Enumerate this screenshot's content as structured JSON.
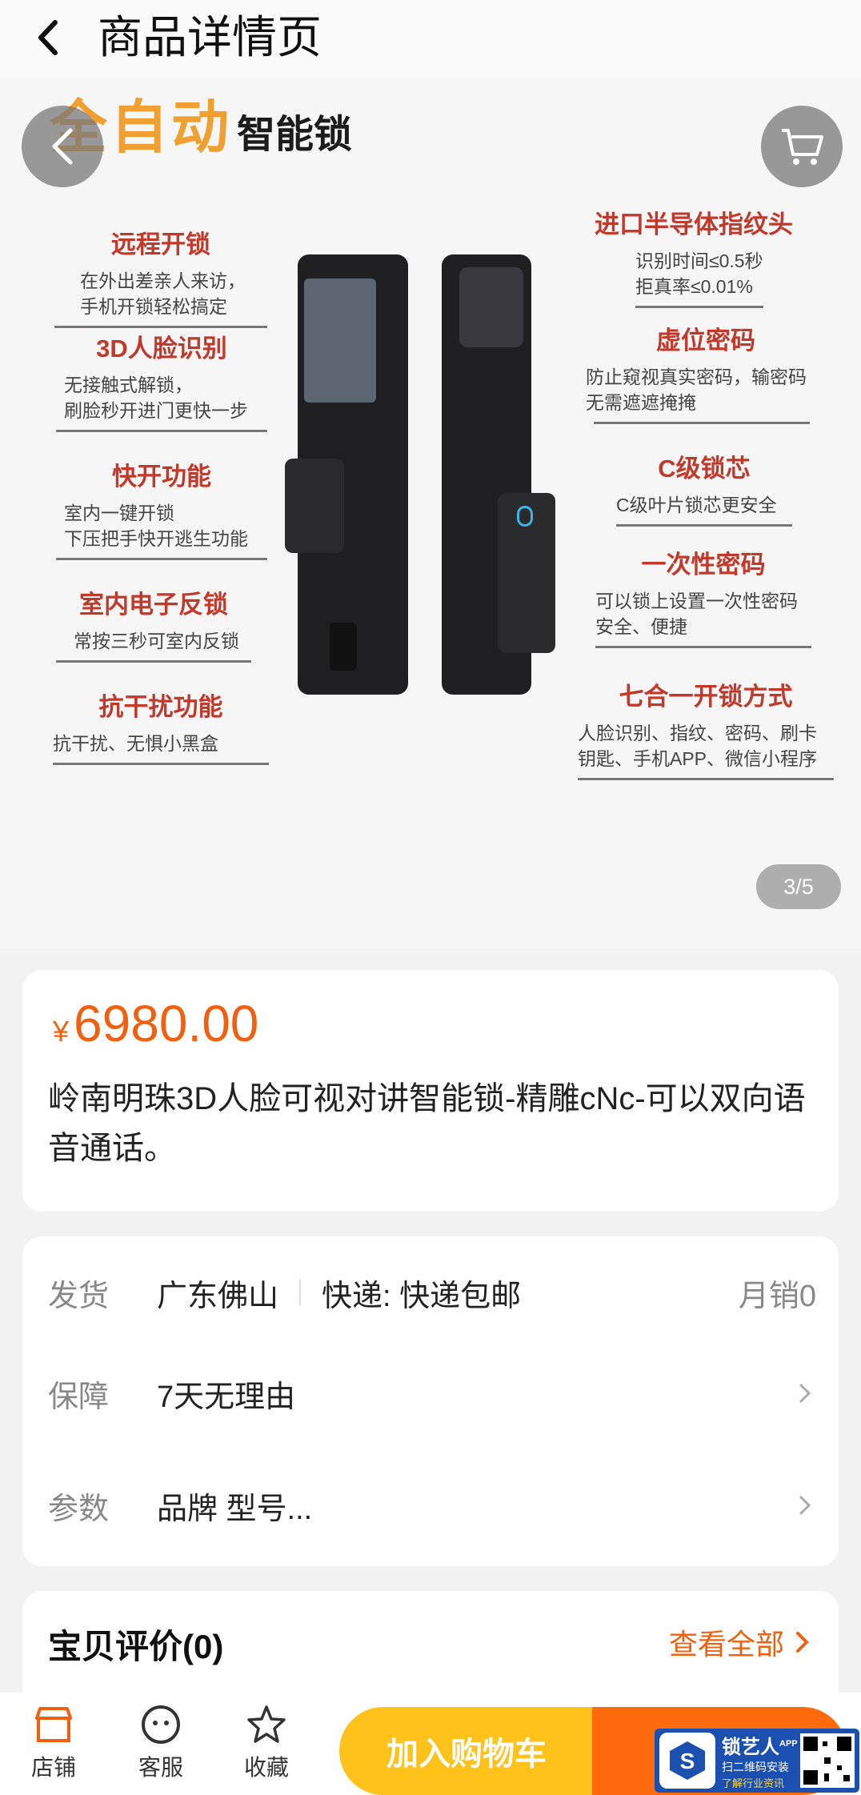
{
  "header": {
    "title": "商品详情页"
  },
  "gallery": {
    "headline_big": "全自动",
    "headline_small": "智能锁",
    "counter": "3/5",
    "features_left": [
      {
        "title": "远程开锁",
        "desc": "在外出差亲人来访，\n手机开锁轻松搞定"
      },
      {
        "title": "3D人脸识别",
        "desc": "无接触式解锁，\n刷脸秒开进门更快一步"
      },
      {
        "title": "快开功能",
        "desc": "室内一键开锁\n下压把手快开逃生功能"
      },
      {
        "title": "室内电子反锁",
        "desc": "常按三秒可室内反锁"
      },
      {
        "title": "抗干扰功能",
        "desc": "抗干扰、无惧小黑盒"
      }
    ],
    "features_right": [
      {
        "title": "进口半导体指纹头",
        "desc": "识别时间≤0.5秒\n拒真率≤0.01%"
      },
      {
        "title": "虚位密码",
        "desc": "防止窥视真实密码，输密码\n无需遮遮掩掩"
      },
      {
        "title": "C级锁芯",
        "desc": "C级叶片锁芯更安全"
      },
      {
        "title": "一次性密码",
        "desc": "可以锁上设置一次性密码\n安全、便捷"
      },
      {
        "title": "七合一开锁方式",
        "desc": "人脸识别、指纹、密码、刷卡\n钥匙、手机APP、微信小程序"
      }
    ]
  },
  "product": {
    "currency": "¥",
    "price": "6980.00",
    "title": "岭南明珠3D人脸可视对讲智能锁-精雕cNc-可以双向语音通话。"
  },
  "info": {
    "ship_label": "发货",
    "ship_from": "广东佛山",
    "express": "快递: 快递包邮",
    "monthly_sales": "月销0",
    "guarantee_label": "保障",
    "guarantee_value": "7天无理由",
    "params_label": "参数",
    "params_value": "品牌 型号..."
  },
  "reviews": {
    "title": "宝贝评价(0)",
    "view_all": "查看全部"
  },
  "bottom": {
    "store": "店铺",
    "service": "客服",
    "favorite": "收藏",
    "add_to_cart": "加入购物车"
  },
  "watermark": {
    "name": "锁艺人",
    "sup": "APP",
    "line1": "扫二维码安装",
    "line2": "了解行业资讯"
  },
  "colors": {
    "accent": "#f06010",
    "cart_button": "#ffc21a",
    "buy_button": "#ff6a0a",
    "feature_title": "#c0392b"
  }
}
